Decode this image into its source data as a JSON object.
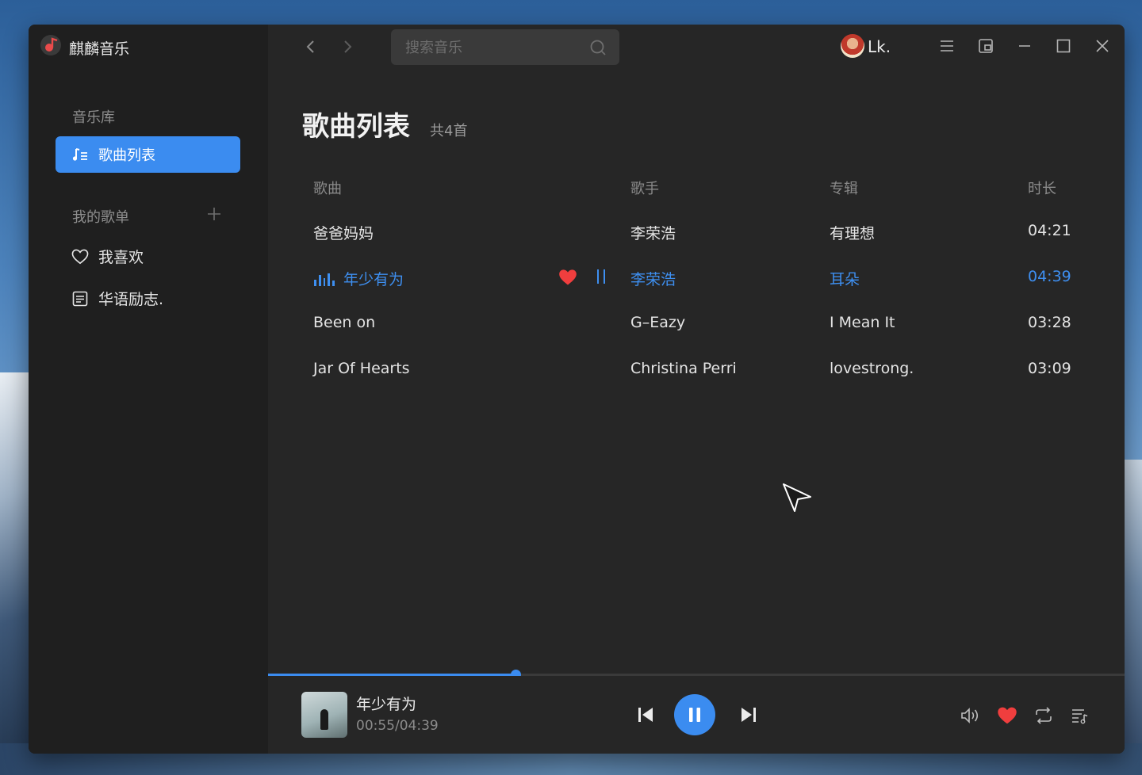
{
  "app": {
    "title": "麒麟音乐"
  },
  "sidebar": {
    "library_label": "音乐库",
    "active_item": "歌曲列表",
    "my_playlists_label": "我的歌单",
    "items": [
      {
        "label": "我喜欢",
        "icon": "heart-outline-icon"
      },
      {
        "label": "华语励志.",
        "icon": "playlist-icon"
      }
    ]
  },
  "search": {
    "placeholder": "搜索音乐"
  },
  "user": {
    "name": "Lk."
  },
  "page": {
    "title": "歌曲列表",
    "count": "共4首"
  },
  "table": {
    "headers": [
      "歌曲",
      "歌手",
      "专辑",
      "时长"
    ],
    "rows": [
      {
        "song": "爸爸妈妈",
        "artist": "李荣浩",
        "album": "有理想",
        "duration": "04:21"
      },
      {
        "song": "年少有为",
        "artist": "李荣浩",
        "album": "耳朵",
        "duration": "04:39",
        "playing": true
      },
      {
        "song": "Been on",
        "artist": "G–Eazy",
        "album": "I Mean It",
        "duration": "03:28"
      },
      {
        "song": "Jar Of Hearts",
        "artist": "Christina Perri",
        "album": "lovestrong.",
        "duration": "03:09"
      }
    ]
  },
  "player": {
    "title": "年少有为",
    "time": "00:55/04:39",
    "progress_fraction": 0.289
  },
  "colors": {
    "accent": "#3b8cf0",
    "heart": "#f03e3e",
    "window_bg": "#262626",
    "sidebar_bg": "#1f1f1f"
  }
}
